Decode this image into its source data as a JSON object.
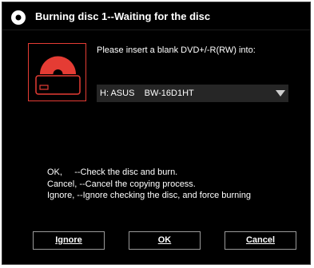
{
  "window": {
    "title": "Burning disc 1--Waiting for the disc",
    "icon": "disc-icon"
  },
  "prompt": "Please insert a blank DVD+/-R(RW) into:",
  "drive_select": {
    "value": "H: ASUS    BW-16D1HT",
    "arrow_icon": "triangle-down-icon"
  },
  "help": {
    "lines": [
      "OK,     --Check the disc and burn.",
      "Cancel, --Cancel the copying process.",
      "Ignore, --Ignore checking the disc, and force burning"
    ]
  },
  "buttons": {
    "ignore": "Ignore",
    "ok": "OK",
    "cancel": "Cancel"
  },
  "colors": {
    "background": "#000000",
    "accent": "#e53c34",
    "text": "#ffffff",
    "select_bg": "#262626"
  }
}
